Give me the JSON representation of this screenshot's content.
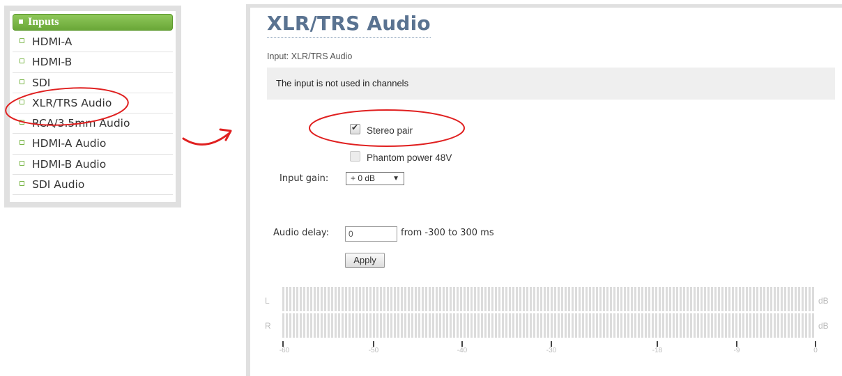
{
  "sidebar": {
    "header": "Inputs",
    "items": [
      {
        "label": "HDMI-A"
      },
      {
        "label": "HDMI-B"
      },
      {
        "label": "SDI"
      },
      {
        "label": "XLR/TRS Audio"
      },
      {
        "label": "RCA/3.5mm Audio"
      },
      {
        "label": "HDMI-A Audio"
      },
      {
        "label": "HDMI-B Audio"
      },
      {
        "label": "SDI Audio"
      }
    ]
  },
  "main": {
    "title": "XLR/TRS Audio",
    "subtitle": "Input: XLR/TRS Audio",
    "notice": "The input is not used in channels",
    "stereo_pair": {
      "label": "Stereo pair",
      "checked": true
    },
    "phantom_power": {
      "label": "Phantom power 48V",
      "checked": false
    },
    "input_gain": {
      "label": "Input gain:",
      "value": "+ 0 dB"
    },
    "audio_delay": {
      "label": "Audio delay:",
      "value": "0",
      "range": "from -300 to 300 ms"
    },
    "apply_label": "Apply"
  },
  "meter": {
    "left_label": "L",
    "right_label": "R",
    "unit": "dB",
    "ticks": [
      "-60",
      "-50",
      "-40",
      "-30",
      "-18",
      "-9",
      "0"
    ]
  },
  "colors": {
    "accent_green": "#6aa738",
    "title_blue": "#5a7391",
    "annotation_red": "#e02020"
  }
}
